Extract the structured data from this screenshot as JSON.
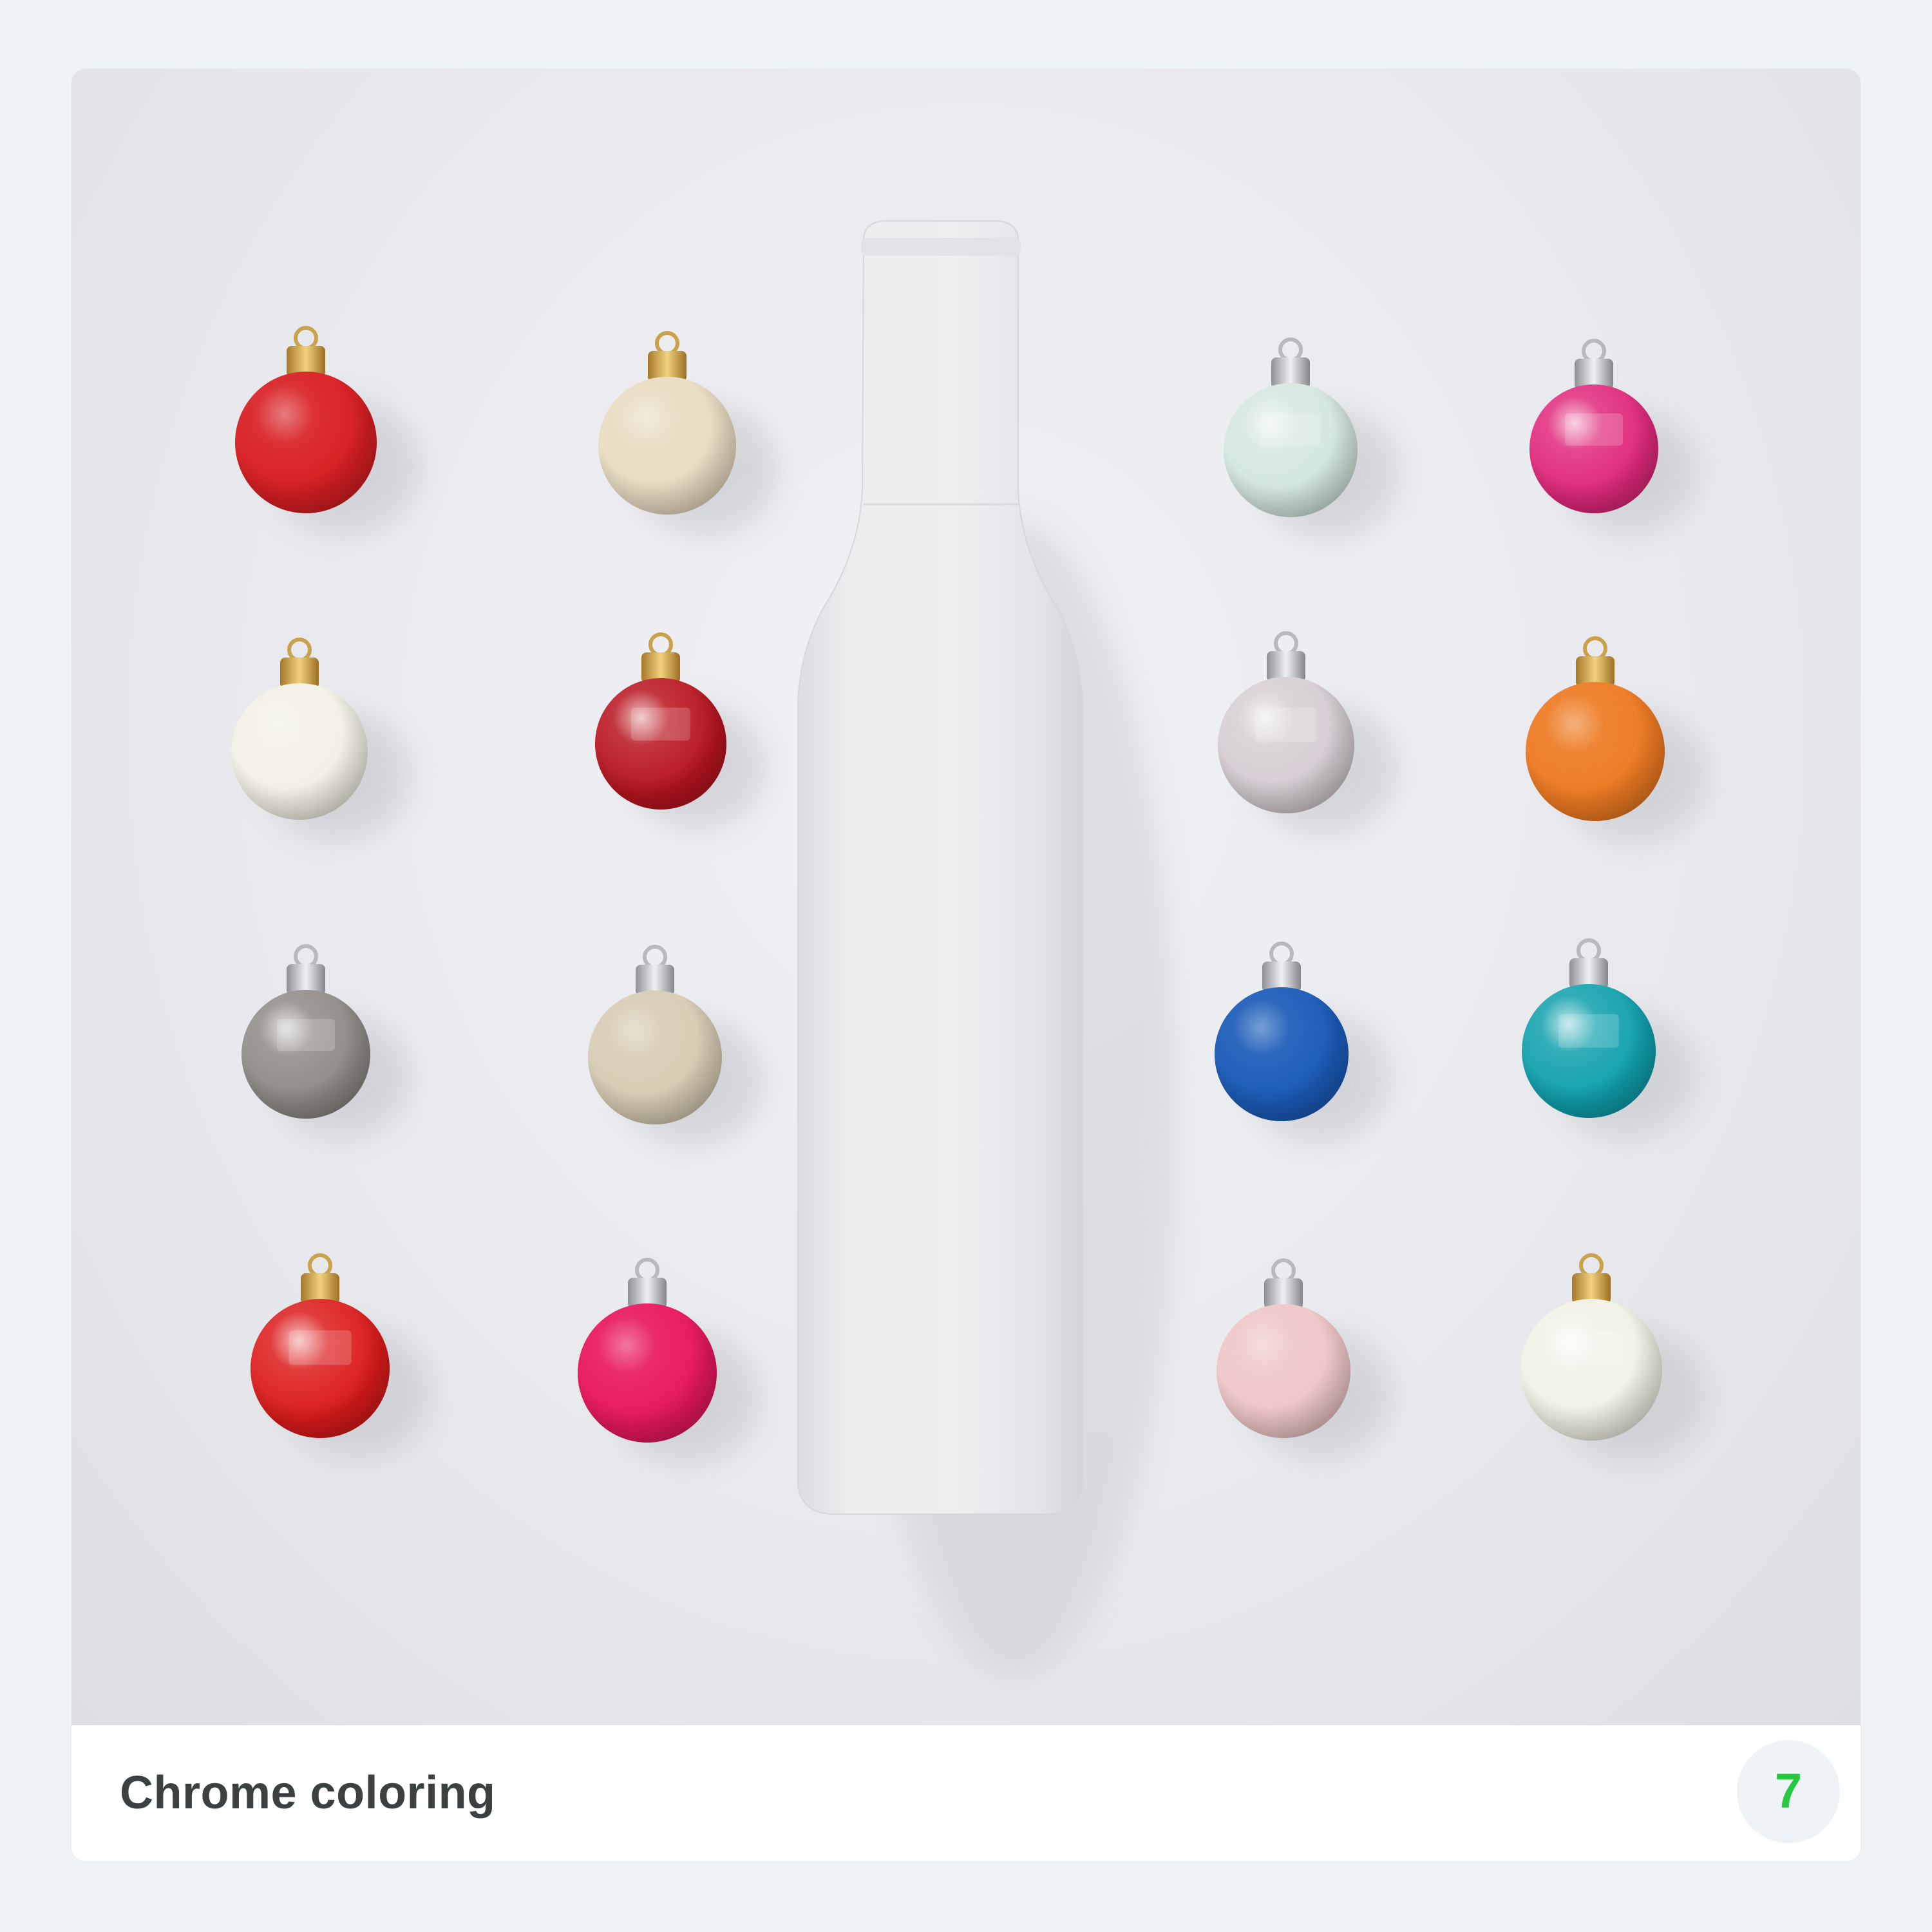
{
  "caption": {
    "title": "Chrome coloring",
    "count": "7"
  },
  "colors": {
    "page_background": "#eef3f7",
    "card_background": "#ffffff",
    "photo_background": "#e8e9ed",
    "caption_text": "#3b4043",
    "badge_background": "#eef3f7",
    "badge_text": "#28c840"
  },
  "ornaments": [
    {
      "color": "#d81e22",
      "finish": "matte",
      "cap": "gold"
    },
    {
      "color": "#e9dcc3",
      "finish": "matte",
      "cap": "gold"
    },
    {
      "color": "#d3e7de",
      "finish": "glossy",
      "cap": "silver"
    },
    {
      "color": "#e0287a",
      "finish": "glossy",
      "cap": "silver"
    },
    {
      "color": "#f3f1e6",
      "finish": "matte",
      "cap": "gold"
    },
    {
      "color": "#b8141e",
      "finish": "glossy",
      "cap": "gold"
    },
    {
      "color": "#d5cdd3",
      "finish": "glossy",
      "cap": "silver"
    },
    {
      "color": "#ee7a22",
      "finish": "matte",
      "cap": "gold"
    },
    {
      "color": "#8f8a86",
      "finish": "glossy",
      "cap": "silver"
    },
    {
      "color": "#d8ccb4",
      "finish": "matte",
      "cap": "silver"
    },
    {
      "color": "#1a5bb8",
      "finish": "matte",
      "cap": "silver"
    },
    {
      "color": "#0fa0ac",
      "finish": "glossy",
      "cap": "silver"
    },
    {
      "color": "#dc1a1a",
      "finish": "glossy",
      "cap": "gold"
    },
    {
      "color": "#e8175e",
      "finish": "matte",
      "cap": "silver"
    },
    {
      "color": "#efc7c8",
      "finish": "matte",
      "cap": "silver"
    },
    {
      "color": "#f2f1e5",
      "finish": "glossy",
      "cap": "gold"
    }
  ],
  "bottle": {
    "color": "#ebebed"
  }
}
